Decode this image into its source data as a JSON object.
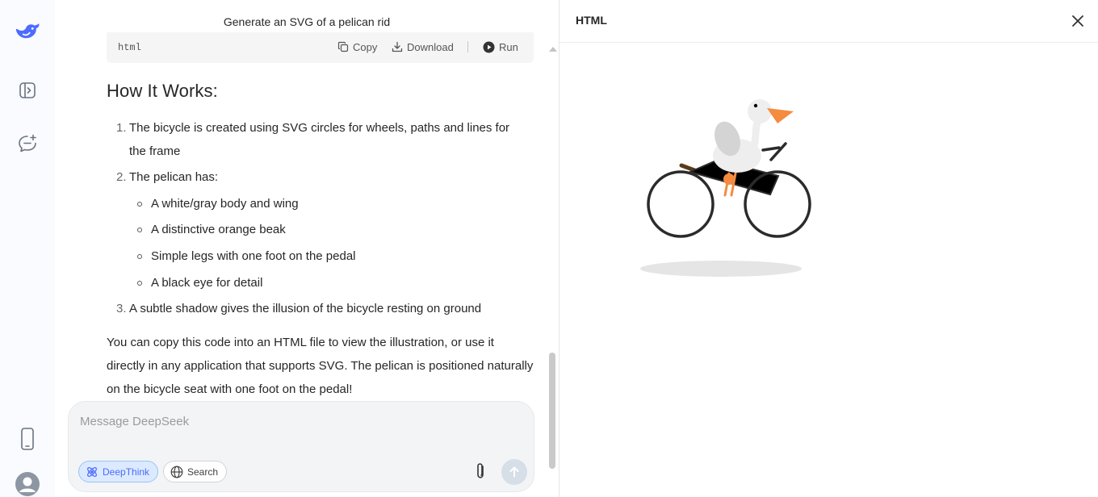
{
  "chat": {
    "title": "Generate an SVG of a pelican rid"
  },
  "code_block": {
    "language": "html",
    "copy_label": "Copy",
    "download_label": "Download",
    "run_label": "Run"
  },
  "answer": {
    "heading": "How It Works:",
    "items": [
      {
        "num": "1.",
        "text": "The bicycle is created using SVG circles for wheels, paths and lines for",
        "text_cont": "the frame"
      },
      {
        "num": "2.",
        "text": "The pelican has:"
      },
      {
        "num": "3.",
        "text": "A subtle shadow gives the illusion of the bicycle resting on ground"
      }
    ],
    "sub_items": [
      "A white/gray body and wing",
      "A distinctive orange beak",
      "Simple legs with one foot on the pedal",
      "A black eye for detail"
    ],
    "paragraph": "You can copy this code into an HTML file to view the illustration, or use it directly in any application that supports SVG. The pelican is positioned naturally on the bicycle seat with one foot on the pedal!"
  },
  "composer": {
    "placeholder": "Message DeepSeek",
    "deepthink_label": "DeepThink",
    "search_label": "Search"
  },
  "preview": {
    "title": "HTML"
  },
  "colors": {
    "accent": "#4d6bfe",
    "beak": "#f58b3e",
    "bike": "#2b2b2b"
  }
}
